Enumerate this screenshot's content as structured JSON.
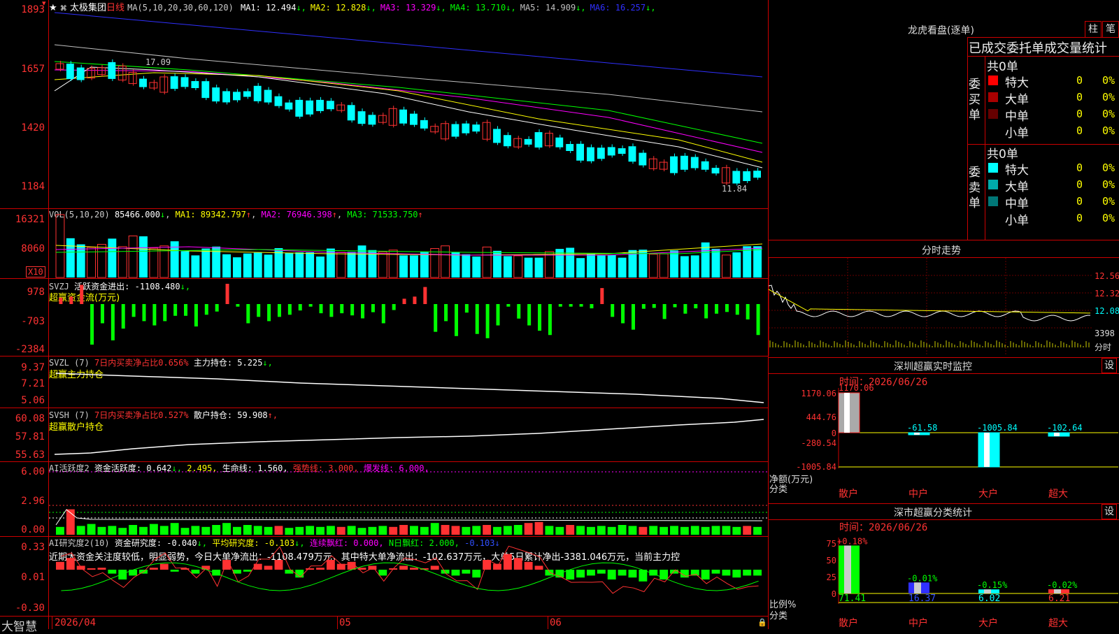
{
  "main": {
    "title": "太极集团",
    "period": "日线",
    "ma_header": "MA(5,10,20,30,60,120)",
    "ma_values": [
      {
        "label": "MA1:",
        "value": "12.494",
        "arrow": "↓",
        "color": "#ffffff"
      },
      {
        "label": "MA2:",
        "value": "12.828",
        "arrow": "↓",
        "color": "#ffff00"
      },
      {
        "label": "MA3:",
        "value": "13.329",
        "arrow": "↓",
        "color": "#ff00ff"
      },
      {
        "label": "MA4:",
        "value": "13.710",
        "arrow": "↓",
        "color": "#00ff00"
      },
      {
        "label": "MA5:",
        "value": "14.909",
        "arrow": "↓",
        "color": "#c0c0c0"
      },
      {
        "label": "MA6:",
        "value": "16.257",
        "arrow": "↓",
        "color": "#3030ff"
      }
    ],
    "yticks": [
      "1893",
      "1657",
      "1420",
      "1184"
    ],
    "high_label": "17.09",
    "low_label": "11.84"
  },
  "vol": {
    "header": "VOL(5,10,20)",
    "value": "85466.000",
    "arrow": "↓",
    "ma1": "MA1: 89342.797",
    "ma2": "MA2: 76946.398",
    "ma3": "MA3: 71533.750",
    "up": "↑",
    "yticks": [
      "16321",
      "8060"
    ],
    "unit": "X10",
    "values": [
      16.5,
      10.3,
      8.7,
      7.9,
      8.7,
      10.2,
      8.1,
      10.9,
      10.8,
      7.7,
      8.3,
      9.5,
      6.9,
      5.8,
      7.6,
      8.1,
      6.1,
      5.3,
      6.3,
      6.5,
      6.0,
      7.7,
      6.4,
      6.6,
      6.6,
      5.5,
      7.6,
      6.6,
      6.7,
      8.4,
      7.2,
      6.7,
      7.2,
      5.8,
      5.8,
      6.8,
      7.6,
      8.3,
      6.7,
      6.1,
      5.5,
      8.0,
      7.0,
      5.6,
      5.7,
      5.2,
      5.2,
      6.8,
      7.5,
      7.8,
      5.1,
      6.2,
      5.8,
      5.9,
      5.2,
      7.2,
      7.3,
      6.1,
      6.2,
      7.1,
      5.6,
      5.8,
      9.2,
      7.5,
      5.9,
      6.6,
      8.2,
      8.2
    ],
    "up_flags": [
      1,
      0,
      0,
      1,
      1,
      0,
      1,
      1,
      0,
      1,
      1,
      0,
      0,
      0,
      0,
      0,
      0,
      0,
      0,
      0,
      0,
      0,
      0,
      0,
      0,
      0,
      0,
      1,
      0,
      0,
      0,
      1,
      1,
      0,
      0,
      0,
      1,
      1,
      0,
      0,
      0,
      1,
      0,
      0,
      1,
      0,
      0,
      1,
      0,
      0,
      0,
      0,
      0,
      0,
      0,
      0,
      0,
      1,
      1,
      0,
      0,
      0,
      0,
      0,
      1,
      0,
      0,
      0
    ]
  },
  "svzj": {
    "name": "SVZJ",
    "label": "活跃资金进出: -1108.480",
    "arrow": "↓,",
    "subtitle": "超赢资金流(万元)",
    "yticks": [
      "978",
      "-703",
      "-2384"
    ],
    "values": [
      300,
      350,
      900,
      -1900,
      -900,
      -1700,
      -1150,
      -600,
      -800,
      -1000,
      -800,
      -550,
      -550,
      -1050,
      -500,
      -350,
      950,
      -120,
      -900,
      -600,
      -800,
      -600,
      -500,
      -300,
      -120,
      -430,
      -600,
      -430,
      -530,
      -670,
      -380,
      -900,
      -280,
      250,
      350,
      800,
      -1300,
      -800,
      -1500,
      -400,
      -1400,
      -1600,
      -1000,
      -120,
      -680,
      -1000,
      -1250,
      -1450,
      -120,
      -120,
      -120,
      -200,
      750,
      -600,
      -900,
      -1200,
      -220,
      -180,
      -700,
      -150,
      -450,
      -200,
      -670,
      -450,
      -370,
      -500,
      -720,
      -1450
    ]
  },
  "svzl": {
    "name": "SVZL (7)",
    "ratio": "7日内买卖净占比0.656%",
    "label": "主力持仓: 5.225",
    "arrow": "↓,",
    "subtitle": "超赢主力持仓",
    "yticks": [
      "9.37",
      "7.21",
      "5.06"
    ]
  },
  "svsh": {
    "name": "SVSH (7)",
    "ratio": "7日内买卖净占比0.527%",
    "label": "散户持仓: 59.908",
    "arrow": "↑,",
    "subtitle": "超赢散户持仓",
    "yticks": [
      "60.08",
      "57.81",
      "55.63"
    ]
  },
  "ai_activity": {
    "name": "AI活跃度2",
    "label": "资金活跃度: 0.642",
    "arrow1": "↓,",
    "v2": "2.495,",
    "life": "生命线: 1.560,",
    "strong": "强势线: 3.000,",
    "burst": "爆发线: 6.000,",
    "yticks": [
      "6.00",
      "2.96",
      "0.00"
    ],
    "values": [
      0.8,
      2.6,
      0.9,
      1.1,
      0.8,
      0.9,
      0.7,
      1.0,
      0.8,
      1.1,
      0.9,
      1.2,
      0.7,
      0.9,
      0.8,
      1.0,
      1.2,
      0.8,
      1.0,
      0.9,
      0.8,
      0.9,
      0.7,
      0.8,
      0.9,
      0.8,
      0.9,
      0.8,
      0.9,
      0.7,
      0.8,
      0.9,
      0.8,
      1.0,
      0.9,
      0.8,
      1.2,
      1.0,
      0.9,
      0.8,
      0.9,
      1.0,
      0.8,
      0.9,
      1.0,
      1.2,
      1.3,
      0.9,
      0.8,
      1.0,
      0.9,
      0.8,
      0.9,
      0.8,
      1.0,
      0.9,
      0.8,
      0.9,
      0.8,
      0.9,
      0.8,
      0.9,
      0.8,
      0.9,
      0.9,
      0.8,
      0.9,
      0.8
    ],
    "red_flags": [
      0,
      1,
      0,
      0,
      0,
      0,
      0,
      0,
      0,
      0,
      0,
      0,
      0,
      0,
      0,
      0,
      0,
      0,
      0,
      0,
      0,
      1,
      0,
      0,
      0,
      0,
      0,
      1,
      0,
      0,
      0,
      0,
      1,
      1,
      0,
      0,
      0,
      1,
      1,
      0,
      0,
      1,
      0,
      0,
      0,
      1,
      1,
      0,
      0,
      1,
      0,
      0,
      0,
      0,
      0,
      0,
      1,
      0,
      0,
      0,
      0,
      0,
      0,
      0,
      0,
      0,
      1,
      0
    ]
  },
  "ai_research": {
    "name": "AI研究度2(10)",
    "label": "资金研究度: -0.040",
    "arrow": "↓,",
    "avg": "平均研究度: -0.103",
    "avg_arrow": "↓,",
    "red": "连续飘红: 0.000,",
    "n_red": "N日飘红: 2.000,",
    "tail": "-0.103",
    "tail_arrow": "↓",
    "yticks": [
      "0.33",
      "0.01",
      "-0.30"
    ],
    "commentary": "近期大资金关注度较低，明显弱势，今日大单净流出：-1108.479万元，其中特大单净流出：-102.637万元，大单5日累计净出-3381.046万元，当前主力控",
    "values": [
      0.04,
      0.06,
      0.02,
      0.0,
      0.01,
      -0.02,
      -0.05,
      -0.03,
      -0.02,
      0.01,
      0.03,
      -0.01,
      0.0,
      -0.02,
      0.02,
      -0.03,
      0.05,
      -0.02,
      -0.01,
      0.03,
      0.02,
      0.05,
      -0.02,
      -0.04,
      0.0,
      0.01,
      0.05,
      0.03,
      0.04,
      0.01,
      0.02,
      -0.03,
      0.0,
      0.02,
      0.01,
      0.0,
      0.02,
      -0.02,
      -0.03,
      -0.02,
      -0.04,
      0.05,
      0.03,
      0.08,
      0.06,
      0.04,
      0.02,
      -0.03,
      -0.04,
      -0.05,
      -0.04,
      -0.03,
      -0.02,
      -0.05,
      -0.03,
      -0.04,
      -0.06,
      -0.03,
      -0.05,
      -0.02,
      -0.04,
      -0.03,
      -0.05,
      -0.02,
      -0.03,
      -0.04,
      -0.03,
      -0.03
    ]
  },
  "timeaxis": {
    "labels": [
      "2026/04",
      "05",
      "06"
    ],
    "brand": "大智慧"
  },
  "right": {
    "lhb_title": "龙虎看盘(逐单)",
    "btn1": "柱",
    "btn2": "笔",
    "tabs_line": "已成交委托单成交量统计",
    "buy_label": "委买单",
    "sell_label": "委卖单",
    "buy_total": "共0单",
    "sell_total": "共0单",
    "buy_rows": [
      {
        "name": "特大",
        "count": "0",
        "pct": "0%",
        "color": "#ff0000"
      },
      {
        "name": "大单",
        "count": "0",
        "pct": "0%",
        "color": "#aa0000"
      },
      {
        "name": "中单",
        "count": "0",
        "pct": "0%",
        "color": "#660000"
      },
      {
        "name": "小单",
        "count": "0",
        "pct": "0%",
        "color": ""
      }
    ],
    "sell_rows": [
      {
        "name": "特大",
        "count": "0",
        "pct": "0%",
        "color": "#00ffff"
      },
      {
        "name": "大单",
        "count": "0",
        "pct": "0%",
        "color": "#00aaaa"
      },
      {
        "name": "中单",
        "count": "0",
        "pct": "0%",
        "color": "#007777"
      },
      {
        "name": "小单",
        "count": "0",
        "pct": "0%",
        "color": ""
      }
    ],
    "intraday_title": "分时走势",
    "intraday_prices": [
      "12.56",
      "12.32",
      "12.08"
    ],
    "intraday_vol": "3398",
    "intraday_unit": "分时",
    "monitor_title": "深圳超赢实时监控",
    "set_btn": "设",
    "monitor_time_label": "时间：",
    "monitor_time": "2026/06/26",
    "monitor_yticks": [
      "1170.06",
      "444.76",
      "0",
      "-280.54",
      "-1005.84"
    ],
    "monitor_ylabel1": "净额(万元)",
    "monitor_ylabel2": "分类",
    "monitor_cats": [
      "散户",
      "中户",
      "大户",
      "超大"
    ],
    "monitor_values": [
      1170.06,
      -61.58,
      -1005.84,
      -102.64
    ],
    "monitor_value_labels": [
      "1170.06",
      "-61.58",
      "-1005.84",
      "-102.64"
    ],
    "class_title": "深市超赢分类统计",
    "class_time_label": "时间：",
    "class_time": "2026/06/26",
    "class_yticks": [
      "75",
      "50",
      "25",
      "0"
    ],
    "class_ylabel1": "比例%",
    "class_ylabel2": "分类",
    "class_pct_labels": [
      "+0.18%",
      "-0.01%",
      "-0.15%",
      "-0.02%"
    ],
    "class_values": [
      71.41,
      16.37,
      6.02,
      6.21
    ],
    "class_value_labels": [
      "71.41",
      "16.37",
      "6.02",
      "6.21"
    ],
    "class_cats": [
      "散户",
      "中户",
      "大户",
      "超大"
    ]
  },
  "colors": {
    "up": "#ff3232",
    "down": "#00ffff",
    "grid": "#cc0000",
    "green": "#00ff00",
    "yellow": "#ffff00",
    "magenta": "#ff00ff"
  }
}
